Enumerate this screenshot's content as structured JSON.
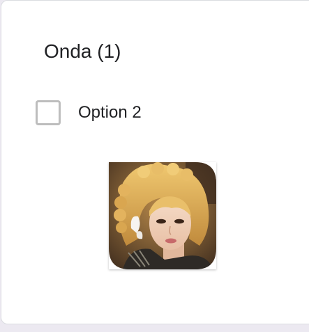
{
  "question": {
    "title": "Onda (1)"
  },
  "options": [
    {
      "label": "Option 2",
      "checked": false,
      "image": "portrait-photo"
    }
  ],
  "colors": {
    "page_background": "#ece9f1",
    "card_background": "#ffffff",
    "checkbox_border": "#bdbdbd",
    "text": "#202124"
  }
}
